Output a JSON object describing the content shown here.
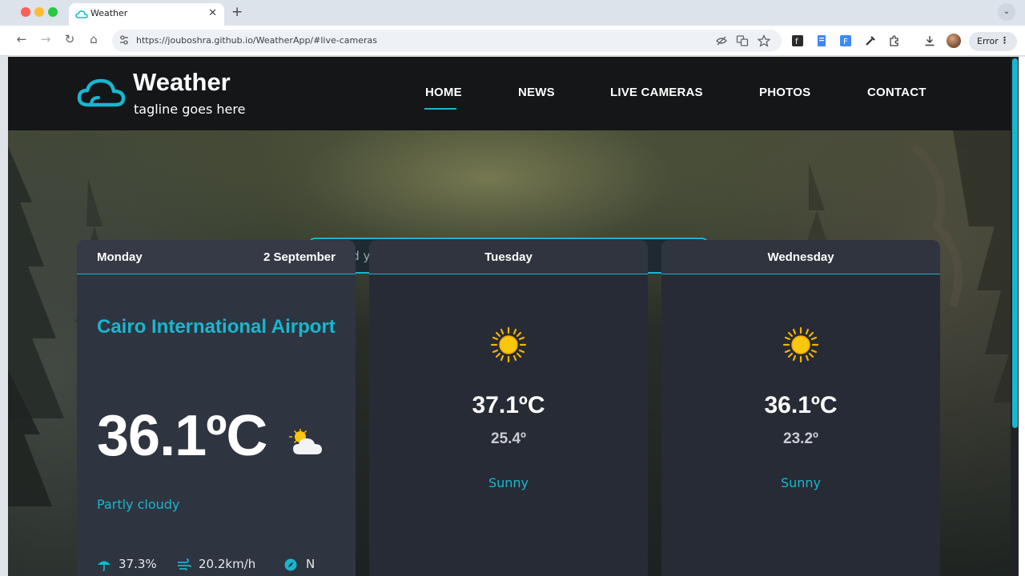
{
  "browser": {
    "tab_title": "Weather",
    "tab_close": "✕",
    "new_tab": "+",
    "tabs_menu": "⌄",
    "url": "https://jouboshra.github.io/WeatherApp/#live-cameras",
    "error_label": "Error",
    "menu_dots": "⋮",
    "nav": {
      "back": "←",
      "forward": "→",
      "reload": "↻",
      "home": "⌂"
    }
  },
  "site": {
    "title": "Weather",
    "tagline": "tagline goes here",
    "nav": [
      "HOME",
      "NEWS",
      "LIVE CAMERAS",
      "PHOTOS",
      "CONTACT"
    ],
    "active_nav": "HOME"
  },
  "search": {
    "placeholder": "Find your location"
  },
  "today": {
    "day": "Monday",
    "date": "2 September",
    "location": "Cairo International Airport",
    "temperature": "36.1ºC",
    "condition": "Partly cloudy",
    "humidity": "37.3%",
    "wind_speed": "20.2km/h",
    "wind_direction": "N"
  },
  "forecast": [
    {
      "day": "Tuesday",
      "high": "37.1ºC",
      "low": "25.4º",
      "condition": "Sunny"
    },
    {
      "day": "Wednesday",
      "high": "36.1ºC",
      "low": "23.2º",
      "condition": "Sunny"
    }
  ],
  "colors": {
    "accent": "#18b7cf",
    "header": "#141618",
    "card": "#2f3441"
  }
}
